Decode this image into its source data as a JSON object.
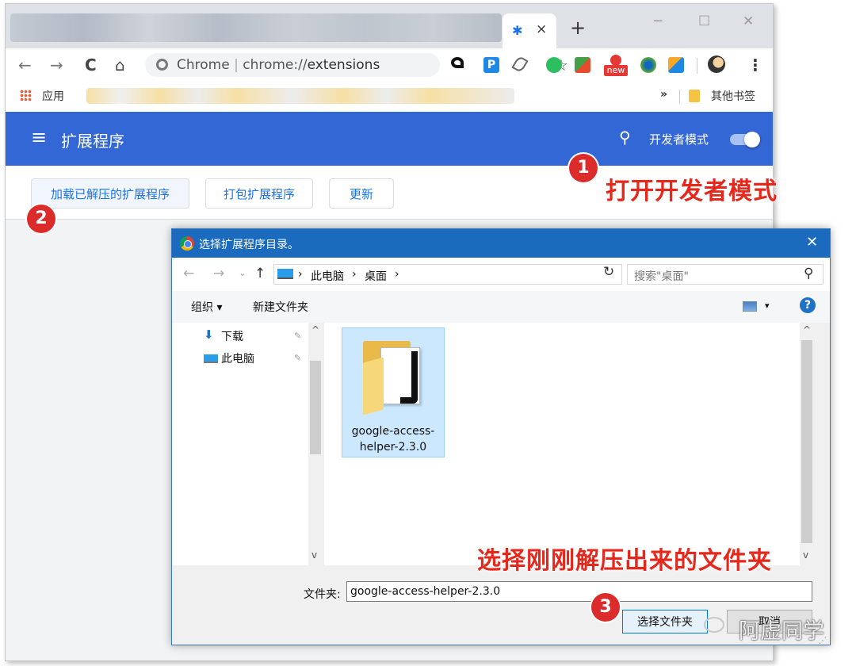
{
  "browser": {
    "active_tab_close": "×",
    "new_tab": "+",
    "window_buttons": [
      "─",
      "☐",
      "✕"
    ],
    "nav": {
      "back": "←",
      "forward": "→",
      "reload": "C",
      "home": "⌂"
    },
    "omnibox": {
      "site": "Chrome",
      "separator": "|",
      "url_prefix": "chrome://",
      "url_path": "extensions"
    },
    "star": "☆",
    "menu": "⋮",
    "extensions": [
      {
        "name": "arrow-ext",
        "color": "#111111"
      },
      {
        "name": "p-ext",
        "color": "#1e88e5",
        "label": "P"
      },
      {
        "name": "leaf-ext",
        "color": "#666666"
      },
      {
        "name": "evernote-ext",
        "color": "#2dbe60"
      },
      {
        "name": "down-ext",
        "color": "#e44c2b"
      },
      {
        "name": "new-ext",
        "color": "#e53935",
        "label": "new"
      },
      {
        "name": "globe-ext",
        "color": "#43a047"
      },
      {
        "name": "tag-ext",
        "color": "#f9a825"
      },
      {
        "name": "profile-ext",
        "color": "#333333"
      }
    ]
  },
  "bookmarks": {
    "apps_label": "应用",
    "more": "»",
    "other_label": "其他书签"
  },
  "extensions_page": {
    "menu_icon": "≡",
    "title": "扩展程序",
    "search_icon": "🔍",
    "dev_mode_label": "开发者模式",
    "dev_mode_on": true,
    "buttons": [
      "加载已解压的扩展程序",
      "打包扩展程序",
      "更新"
    ]
  },
  "dialog": {
    "title": "选择扩展程序目录。",
    "close": "✕",
    "nav": {
      "back": "←",
      "forward": "→",
      "dropdown": "⌄",
      "up": "↑"
    },
    "breadcrumb": [
      "›",
      "此电脑",
      "›",
      "桌面",
      "›"
    ],
    "address_chevron": "∨",
    "refresh": "↻",
    "search_placeholder": "搜索\"桌面\"",
    "search_icon": "⚲",
    "commands": {
      "organize": "组织 ▾",
      "new_folder": "新建文件夹",
      "view_arrow": "▾",
      "help": "?"
    },
    "nav_items": [
      {
        "label": "下载",
        "icon": "⬇",
        "pin": "📌"
      },
      {
        "label": "此电脑",
        "icon": "💻",
        "pin": "📌"
      }
    ],
    "scroll_up": "^",
    "scroll_down": "v",
    "files": [
      {
        "name": "google-access-helper-2.3.0"
      }
    ],
    "filename_label": "文件夹:",
    "filename_value": "google-access-helper-2.3.0",
    "select_button": "选择文件夹",
    "cancel_button": "取消",
    "grip": "⋰"
  },
  "annotations": {
    "step1": {
      "number": "1",
      "text": "打开开发者模式"
    },
    "step2": {
      "number": "2"
    },
    "step3": {
      "number": "3",
      "text": "选择刚刚解压出来的文件夹"
    }
  },
  "watermark": {
    "text": "阿虚同学"
  },
  "colors": {
    "header_blue": "#3367d6",
    "dialog_blue": "#1a6bbd",
    "link_blue": "#1a73e8",
    "annotation_red": "#e6271c"
  }
}
